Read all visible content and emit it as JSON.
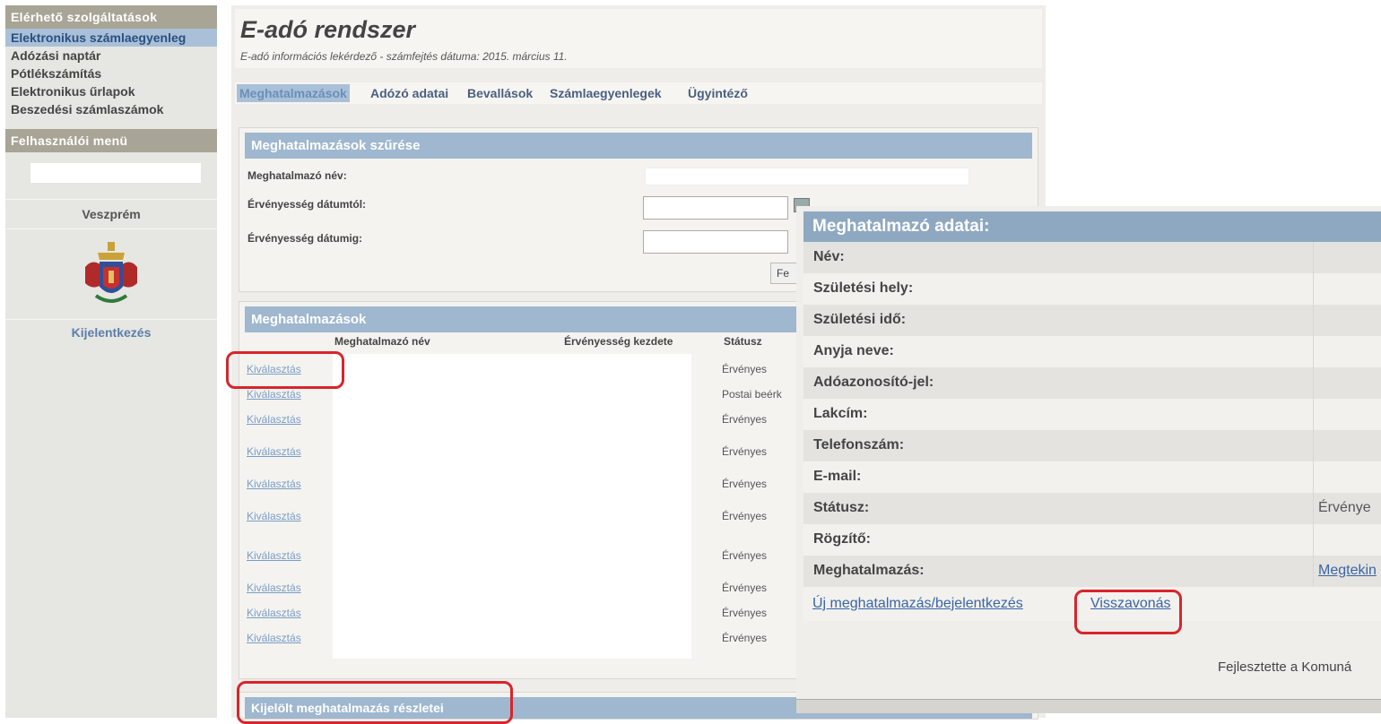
{
  "sidebar": {
    "services_heading": "Elérhető szolgáltatások",
    "items": [
      {
        "label": "Elektronikus számlaegyenleg"
      },
      {
        "label": "Adózási naptár"
      },
      {
        "label": "Pótlékszámítás"
      },
      {
        "label": "Elektronikus űrlapok"
      },
      {
        "label": "Beszedési számlaszámok"
      }
    ],
    "user_menu_heading": "Felhasználói menü",
    "city": "Veszprém",
    "logout": "Kijelentkezés"
  },
  "header": {
    "title": "E-adó rendszer",
    "subtitle": "E-adó információs lekérdező - számfejtés dátuma: 2015. március 11."
  },
  "tabs": [
    {
      "label": "Meghatalmazások"
    },
    {
      "label": "Adózó adatai"
    },
    {
      "label": "Bevallások"
    },
    {
      "label": "Számlaegyenlegek"
    },
    {
      "label": "Ügyintéző"
    }
  ],
  "filter": {
    "heading": "Meghatalmazások szűrése",
    "name_label": "Meghatalmazó név:",
    "from_label": "Érvényesség dátumtól:",
    "to_label": "Érvényesség dátumig:",
    "button_label": "Fe"
  },
  "list": {
    "heading": "Meghatalmazások",
    "columns": [
      "Meghatalmazó név",
      "Érvényesség kezdete",
      "Státusz"
    ],
    "rows": [
      {
        "link": "Kiválasztás",
        "status": "Érvényes"
      },
      {
        "link": "Kiválasztás",
        "status": "Postai beérk"
      },
      {
        "link": "Kiválasztás",
        "status": "Érvényes"
      },
      {
        "link": "Kiválasztás",
        "status": "Érvényes"
      },
      {
        "link": "Kiválasztás",
        "status": "Érvényes"
      },
      {
        "link": "Kiválasztás",
        "status": "Érvényes"
      },
      {
        "link": "Kiválasztás",
        "status": "Érvényes"
      },
      {
        "link": "Kiválasztás",
        "status": "Érvényes"
      },
      {
        "link": "Kiválasztás",
        "status": "Érvényes"
      },
      {
        "link": "Kiválasztás",
        "status": "Érvényes"
      }
    ]
  },
  "details": {
    "heading": "Kijelölt meghatalmazás részletei"
  },
  "dialog": {
    "heading": "Meghatalmazó adatai:",
    "fields": [
      {
        "label": "Név:",
        "value": ""
      },
      {
        "label": "Születési hely:",
        "value": ""
      },
      {
        "label": "Születési idő:",
        "value": ""
      },
      {
        "label": "Anyja neve:",
        "value": ""
      },
      {
        "label": "Adóazonosító-jel:",
        "value": ""
      },
      {
        "label": "Lakcím:",
        "value": ""
      },
      {
        "label": "Telefonszám:",
        "value": ""
      },
      {
        "label": "E-mail:",
        "value": ""
      },
      {
        "label": "Státusz:",
        "value": "Érvénye"
      },
      {
        "label": "Rögzítő:",
        "value": ""
      },
      {
        "label": "Meghatalmazás:",
        "value": "Megtekin"
      }
    ],
    "new_link": "Új meghatalmazás/bejelentkezés",
    "revoke_link": "Visszavonás",
    "footer": "Fejlesztette a Komuná"
  },
  "colors": {
    "accent_blue": "#9fb7cf",
    "sidebar_head": "#a8a596",
    "highlight_red": "#d9242b"
  }
}
